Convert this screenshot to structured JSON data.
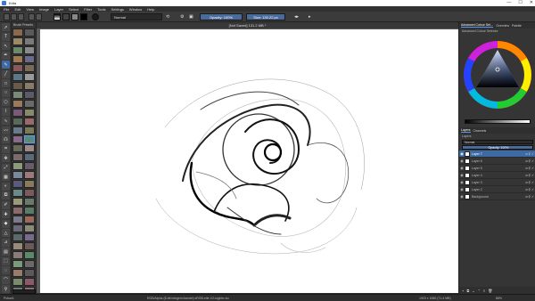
{
  "window": {
    "title": "Krita",
    "min": "—",
    "max": "☐",
    "close": "✕"
  },
  "menu": [
    "File",
    "Edit",
    "View",
    "Image",
    "Layer",
    "Select",
    "Filter",
    "Tools",
    "Settings",
    "Window",
    "Help"
  ],
  "toolbar": {
    "blend_mode": "Normal",
    "opacity": "Opacity: 100%",
    "size": "Size: 130.22 px"
  },
  "canvas": {
    "tab_title": "[Not Saved] 131.2 MB *"
  },
  "brush_presets": {
    "title": "Brush Presets"
  },
  "dock": {
    "tabs": [
      "Advanced Colour Sel…",
      "Overview",
      "Palette"
    ],
    "selector_title": "Advanced Colour Selector",
    "layer_tabs": [
      "Layers",
      "Channels"
    ],
    "layers_label": "Layers",
    "blend_label": "Normal",
    "opacity_label": "Opacity: 100%",
    "layers": [
      {
        "name": "Layer 7",
        "selected": true
      },
      {
        "name": "Layer 6",
        "selected": false
      },
      {
        "name": "Layer 5",
        "selected": false
      },
      {
        "name": "Layer 4",
        "selected": false
      },
      {
        "name": "Layer 3",
        "selected": false
      },
      {
        "name": "Layer 2",
        "selected": false
      },
      {
        "name": "Background",
        "selected": false
      }
    ]
  },
  "status": {
    "left": "Pulsar1",
    "center": "RGB/Alpha (8-bit integer/channel) sRGB-elle-V2-srgbtrc.icc",
    "right": "1920 x 1080 (71.4 MB)",
    "zoom": "86%"
  },
  "colors": {
    "accent": "#3d6aa5",
    "panel": "#353535",
    "canvas": "#ffffff"
  }
}
